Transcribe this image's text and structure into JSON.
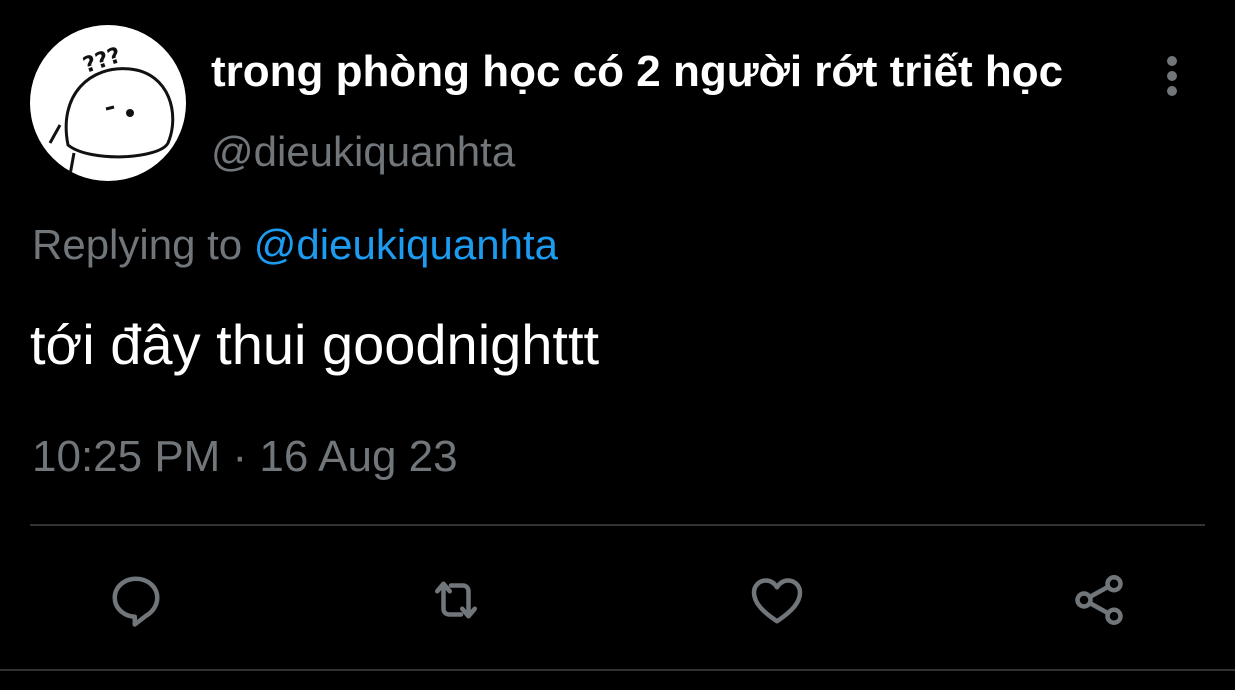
{
  "tweet": {
    "display_name": "trong phòng học có 2 người rớt triết học",
    "handle": "@dieukiquanhta",
    "replying_prefix": "Replying to",
    "replying_to": "@dieukiquanhta",
    "text": "tới đây thui goodnighttt",
    "timestamp": "10:25 PM · 16 Aug 23",
    "avatar_text": "???"
  },
  "actions": [
    {
      "name": "reply",
      "icon": "reply-icon"
    },
    {
      "name": "retweet",
      "icon": "retweet-icon"
    },
    {
      "name": "like",
      "icon": "heart-icon"
    },
    {
      "name": "share",
      "icon": "share-icon"
    }
  ],
  "colors": {
    "background": "#000000",
    "primary_text": "#ffffff",
    "secondary_text": "#71767b",
    "link": "#1d9bf0",
    "divider": "#2f3336"
  }
}
